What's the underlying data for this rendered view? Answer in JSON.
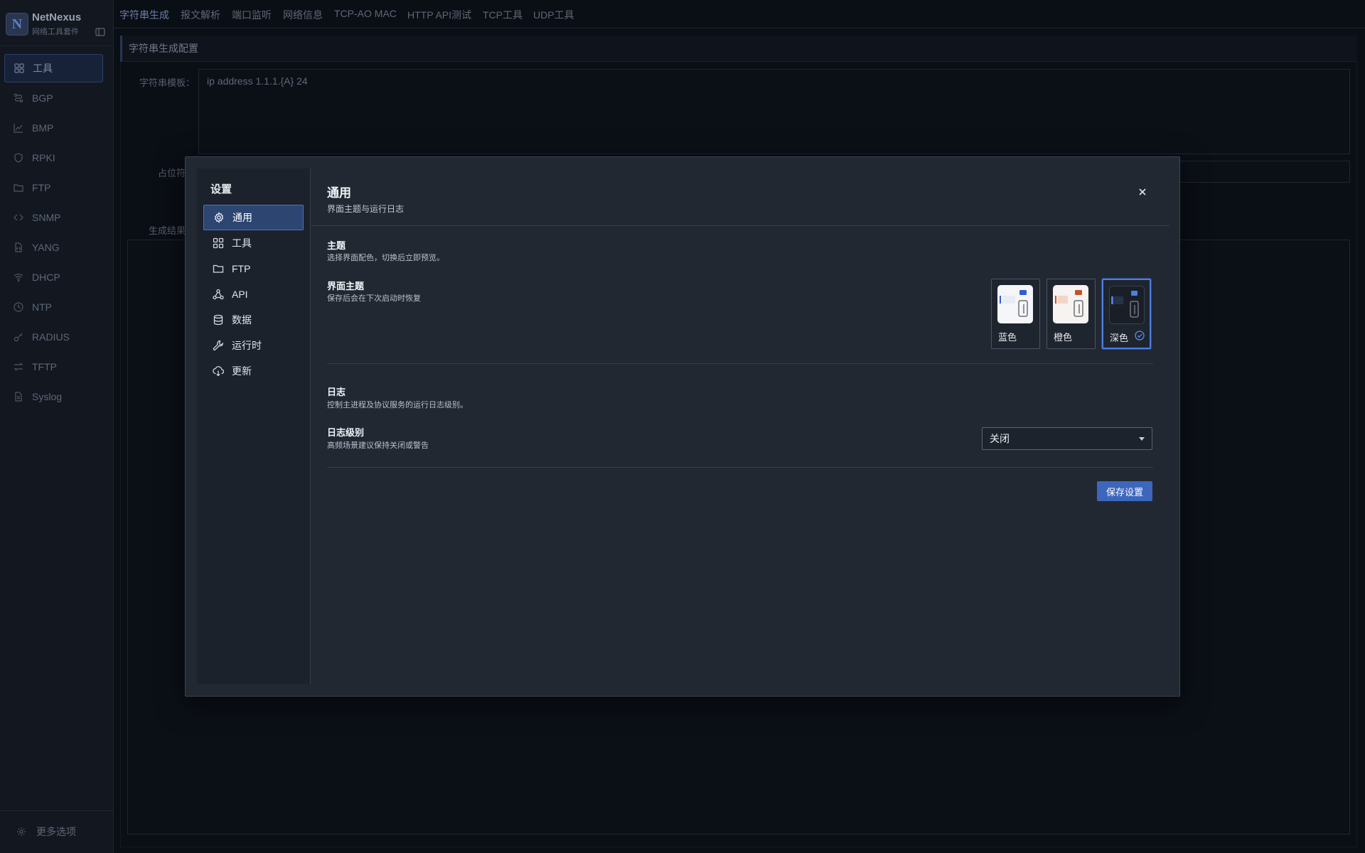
{
  "app": {
    "name": "NetNexus",
    "subtitle": "网络工具套件",
    "logo_letter": "N"
  },
  "sidebar": {
    "items": [
      {
        "label": "工具",
        "icon": "grid-icon",
        "active": true
      },
      {
        "label": "BGP",
        "icon": "route-icon"
      },
      {
        "label": "BMP",
        "icon": "chart-icon"
      },
      {
        "label": "RPKI",
        "icon": "shield-icon"
      },
      {
        "label": "FTP",
        "icon": "folder-icon"
      },
      {
        "label": "SNMP",
        "icon": "code-icon"
      },
      {
        "label": "YANG",
        "icon": "file-code-icon"
      },
      {
        "label": "DHCP",
        "icon": "wifi-icon"
      },
      {
        "label": "NTP",
        "icon": "clock-icon"
      },
      {
        "label": "RADIUS",
        "icon": "key-icon"
      },
      {
        "label": "TFTP",
        "icon": "transfer-icon"
      },
      {
        "label": "Syslog",
        "icon": "document-icon"
      }
    ],
    "more_label": "更多选项"
  },
  "tabs": [
    "字符串生成",
    "报文解析",
    "端口监听",
    "网络信息",
    "TCP-AO MAC",
    "HTTP API测试",
    "TCP工具",
    "UDP工具"
  ],
  "background": {
    "section_title": "字符串生成配置",
    "template_label": "字符串模板：",
    "template_value": "ip address 1.1.1.{A} 24",
    "placeholder_label": "占位符",
    "result_label": "生成结果"
  },
  "settings_modal": {
    "title": "设置",
    "nav": [
      {
        "label": "通用",
        "icon": "gear-icon",
        "active": true
      },
      {
        "label": "工具",
        "icon": "grid-icon"
      },
      {
        "label": "FTP",
        "icon": "folder-icon"
      },
      {
        "label": "API",
        "icon": "api-icon"
      },
      {
        "label": "数据",
        "icon": "database-icon"
      },
      {
        "label": "运行时",
        "icon": "wrench-icon"
      },
      {
        "label": "更新",
        "icon": "cloud-download-icon"
      }
    ],
    "header_title": "通用",
    "header_subtitle": "界面主题与运行日志",
    "theme_section": {
      "title": "主题",
      "desc": "选择界面配色，切换后立即预览。",
      "row_title": "界面主题",
      "row_desc": "保存后会在下次启动时恢复",
      "options": [
        {
          "label": "蓝色",
          "accent": "#2f5fcf",
          "bg": "#f4f6fa",
          "selected": false
        },
        {
          "label": "橙色",
          "accent": "#c8502a",
          "bg": "#f7f3f1",
          "selected": false
        },
        {
          "label": "深色",
          "accent": "#4f7fdc",
          "bg": "#1a1f27",
          "selected": true
        }
      ]
    },
    "log_section": {
      "title": "日志",
      "desc": "控制主进程及协议服务的运行日志级别。",
      "row_title": "日志级别",
      "row_desc": "高频场景建议保持关闭或警告",
      "selected_value": "关闭"
    },
    "save_label": "保存设置"
  }
}
